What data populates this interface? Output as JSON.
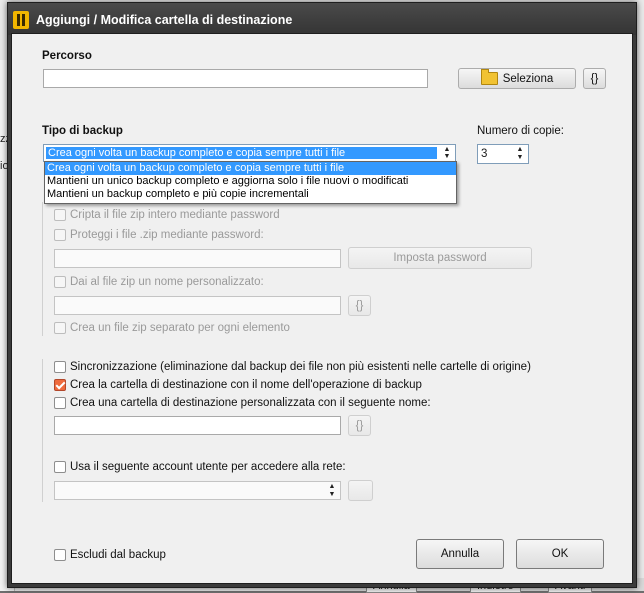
{
  "background": {
    "side_text_1": "zz",
    "side_text_2": "io",
    "buttons": [
      "Annulla",
      "Indietro",
      "Avanti"
    ]
  },
  "dialog": {
    "title": "Aggiungi / Modifica cartella di destinazione",
    "path_section": {
      "label": "Percorso",
      "value": "",
      "browse_label": "Seleziona",
      "variables_label": "{}"
    },
    "backup_type": {
      "label": "Tipo di backup",
      "selected": "Crea ogni volta un backup completo e copia sempre tutti i file",
      "options": [
        "Crea ogni volta un backup completo e copia sempre tutti i file",
        "Mantieni un unico backup completo e aggiorna solo i file nuovi o modificati",
        "Mantieni un backup completo e più copie incrementali"
      ]
    },
    "copies": {
      "label": "Numero di copie:",
      "value": "3"
    },
    "zip_options": {
      "encrypt_label": "Cripta il file zip intero mediante password",
      "protect_label": "Proteggi i file .zip mediante password:",
      "set_password_label": "Imposta password",
      "custom_name_label": "Dai al file zip un nome personalizzato:",
      "custom_name_vars": "{}",
      "separate_label": "Crea un file zip separato per ogni elemento"
    },
    "sync_label": "Sincronizzazione (eliminazione dal backup dei file non più esistenti nelle cartelle di origine)",
    "create_named_folder_label": "Crea la cartella di destinazione con il nome dell'operazione di backup",
    "create_named_folder_checked": true,
    "custom_folder_label": "Crea una cartella di destinazione personalizzata con il seguente nome:",
    "custom_folder_vars": "{}",
    "network_account_label": "Usa il seguente account utente per accedere alla rete:",
    "exclude_label": "Escludi dal backup",
    "cancel_label": "Annulla",
    "ok_label": "OK"
  },
  "colors": {
    "accent_check": "#ef6a3c",
    "selection": "#3399ff",
    "titlebar": "#3b3b3b"
  }
}
